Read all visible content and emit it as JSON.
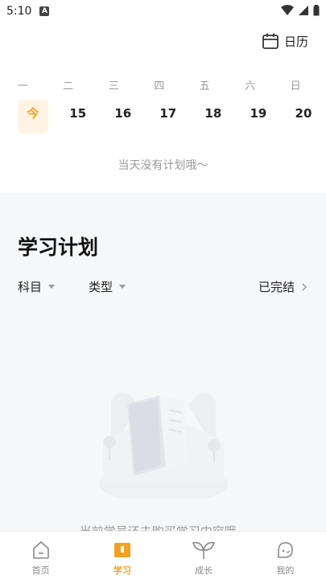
{
  "status_bar": {
    "time": "5:10",
    "indicator": "A"
  },
  "calendar": {
    "button_label": "日历",
    "weekdays": [
      "一",
      "二",
      "三",
      "四",
      "五",
      "六",
      "日"
    ],
    "dates": [
      "今",
      "15",
      "16",
      "17",
      "18",
      "19",
      "20"
    ],
    "empty_text": "当天没有计划哦～"
  },
  "plan": {
    "title": "学习计划",
    "filters": {
      "subject": "科目",
      "type": "类型",
      "finished": "已完结"
    },
    "empty_text": "当前学员还未购买学习内容哦~"
  },
  "nav": {
    "items": [
      {
        "label": "首页",
        "icon": "home-icon"
      },
      {
        "label": "学习",
        "icon": "book-icon"
      },
      {
        "label": "成长",
        "icon": "sprout-icon"
      },
      {
        "label": "我的",
        "icon": "profile-icon"
      }
    ],
    "active_index": 1
  },
  "colors": {
    "accent": "#f5a020",
    "section_bg": "#f6f7f9",
    "muted_text": "#9a9a9a"
  }
}
